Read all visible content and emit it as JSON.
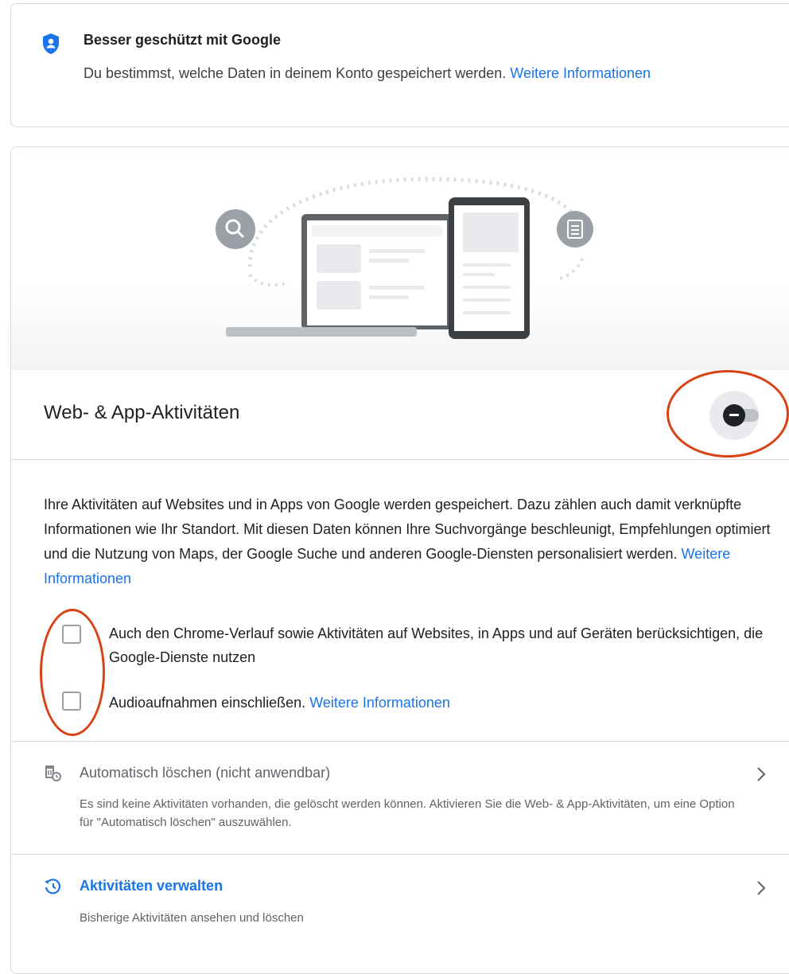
{
  "protection_banner": {
    "title": "Besser geschützt mit Google",
    "text": "Du bestimmst, welche Daten in deinem Konto gespeichert werden.",
    "link": "Weitere Informationen",
    "icon": "shield-person-icon"
  },
  "activity": {
    "title": "Web- & App-Aktivitäten",
    "toggle_state": "off",
    "description": "Ihre Aktivitäten auf Websites und in Apps von Google werden gespeichert. Dazu zählen auch damit verknüpfte Informationen wie Ihr Standort. Mit diesen Daten können Ihre Suchvorgänge beschleunigt, Empfehlungen optimiert und die Nutzung von Maps, der Google Suche und anderen Google-Diensten personalisiert werden.",
    "description_link": "Weitere Informationen",
    "options": [
      {
        "label": "Auch den Chrome-Verlauf sowie Aktivitäten auf Websites, in Apps und auf Geräten berücksichtigen, die Google-Dienste nutzen",
        "checked": false
      },
      {
        "label": "Audioaufnahmen einschließen.",
        "link": "Weitere Informationen",
        "checked": false
      }
    ]
  },
  "auto_delete": {
    "title": "Automatisch löschen (nicht anwendbar)",
    "text": "Es sind keine Aktivitäten vorhanden, die gelöscht werden können. Aktivieren Sie die Web- & App-Aktivitäten, um eine Option für \"Automatisch löschen\" auszuwählen.",
    "icon": "auto-delete-icon"
  },
  "manage": {
    "title": "Aktivitäten verwalten",
    "text": "Bisherige Aktivitäten ansehen und löschen",
    "icon": "history-icon"
  },
  "colors": {
    "link": "#1a73e8",
    "annotation": "#d84315",
    "disabled_text": "#5f6368"
  }
}
